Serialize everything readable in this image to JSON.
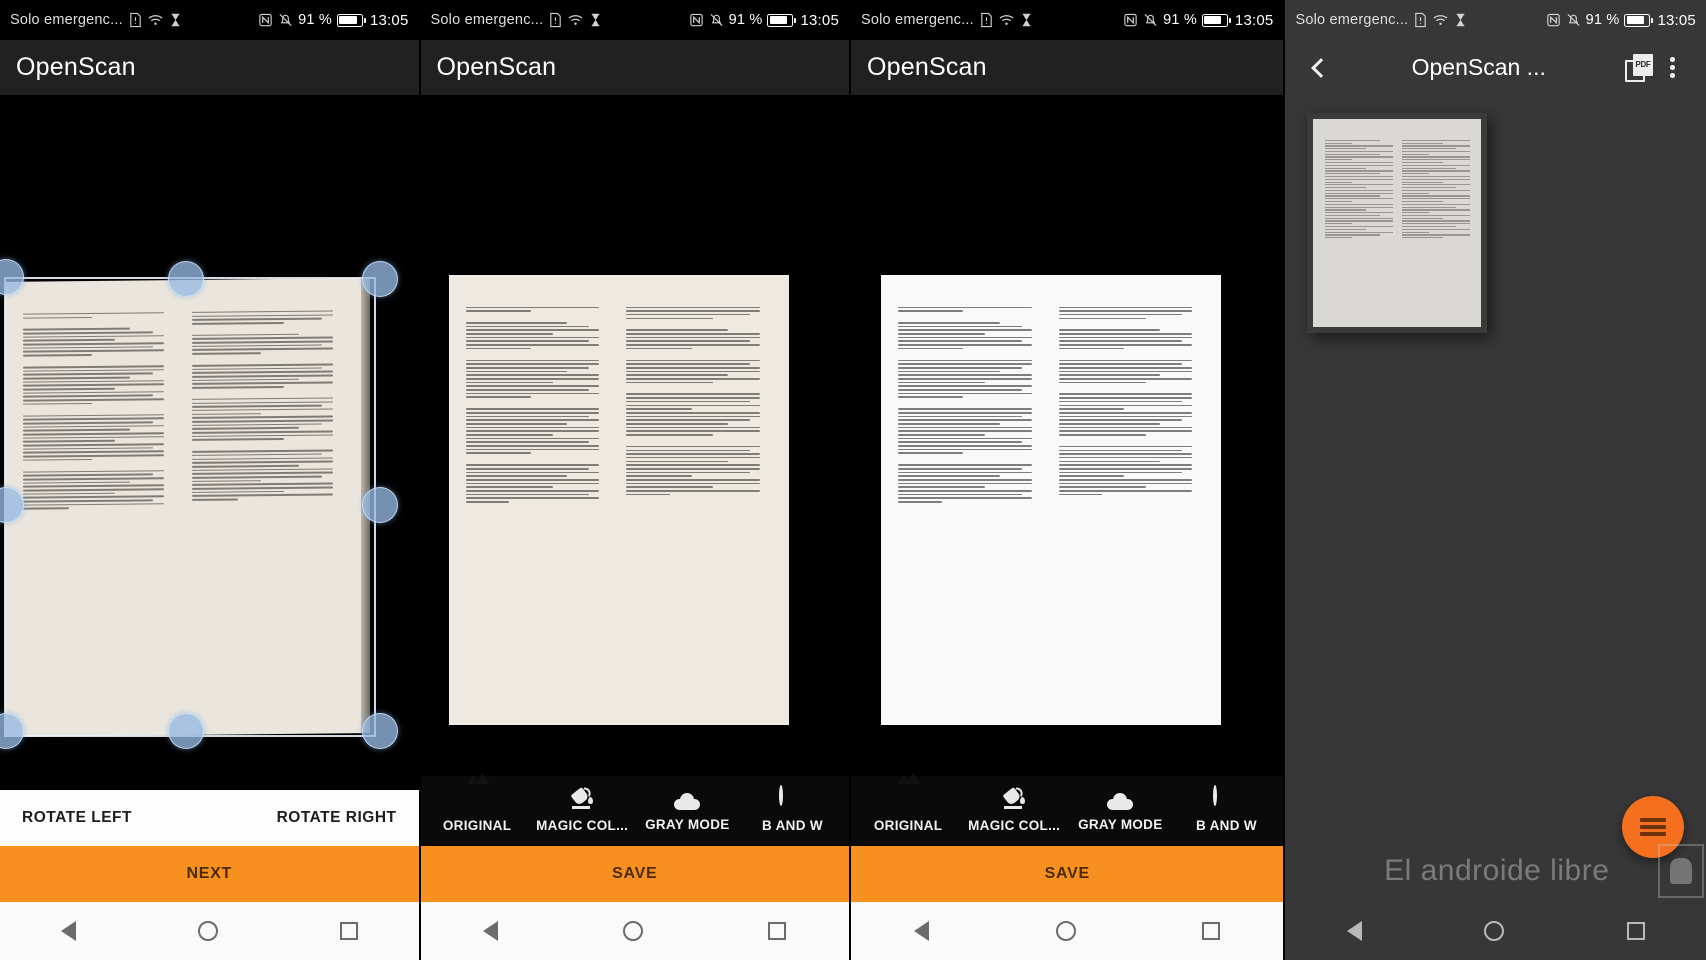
{
  "statusbar": {
    "carrier": "Solo emergenc...",
    "battery_percent": "91 %",
    "time": "13:05",
    "icons": [
      "sim-card-icon",
      "wifi-icon",
      "hourglass-icon",
      "nfc-icon",
      "bell-off-icon",
      "battery-icon"
    ]
  },
  "panel1": {
    "app_title": "OpenScan",
    "rotate_left": "ROTATE LEFT",
    "rotate_right": "ROTATE RIGHT",
    "primary_action": "NEXT",
    "crop_handles": 6
  },
  "panel2": {
    "app_title": "OpenScan",
    "filters": [
      {
        "label": "ORIGINAL",
        "icon": "photo-icon"
      },
      {
        "label": "MAGIC COL...",
        "icon": "paint-bucket-icon"
      },
      {
        "label": "GRAY MODE",
        "icon": "cloud-icon"
      },
      {
        "label": "B AND W",
        "icon": "contrast-icon"
      }
    ],
    "primary_action": "SAVE"
  },
  "panel3": {
    "app_title": "OpenScan",
    "filters": [
      {
        "label": "ORIGINAL",
        "icon": "photo-icon"
      },
      {
        "label": "MAGIC COL...",
        "icon": "paint-bucket-icon"
      },
      {
        "label": "GRAY MODE",
        "icon": "cloud-icon"
      },
      {
        "label": "B AND W",
        "icon": "contrast-icon"
      }
    ],
    "primary_action": "SAVE"
  },
  "panel4": {
    "app_title": "OpenScan ...",
    "back_icon": "chevron-left-icon",
    "pdf_label": "PDF",
    "overflow_icon": "kebab-menu-icon",
    "fab_icon": "hamburger-menu-icon",
    "watermark": "El androide libre"
  },
  "navbar": {
    "back": "back-triangle",
    "home": "home-circle",
    "recents": "recents-square"
  },
  "colors": {
    "accent_orange": "#F7901E",
    "fab_orange": "#F4701F",
    "appbar_dark": "#212121",
    "appbar_grey": "#373737",
    "crop_handle": "#96B9E1"
  }
}
